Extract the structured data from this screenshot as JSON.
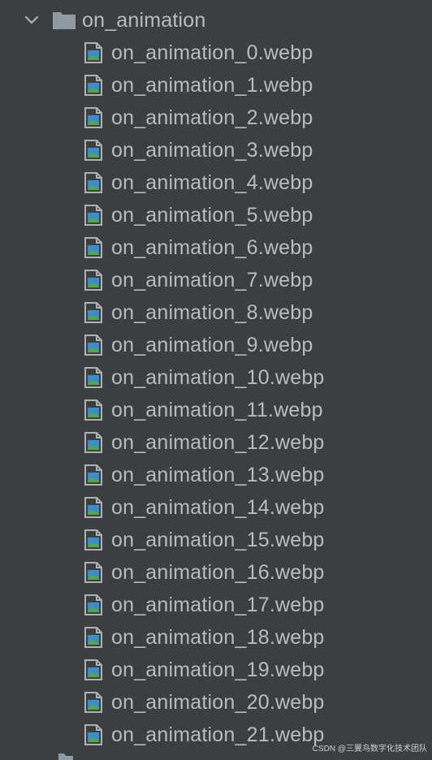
{
  "folder": {
    "name": "on_animation",
    "expanded": true,
    "chevron_icon": "chevron-down-icon",
    "icon": "folder-icon"
  },
  "files": [
    {
      "name": "on_animation_0.webp"
    },
    {
      "name": "on_animation_1.webp"
    },
    {
      "name": "on_animation_2.webp"
    },
    {
      "name": "on_animation_3.webp"
    },
    {
      "name": "on_animation_4.webp"
    },
    {
      "name": "on_animation_5.webp"
    },
    {
      "name": "on_animation_6.webp"
    },
    {
      "name": "on_animation_7.webp"
    },
    {
      "name": "on_animation_8.webp"
    },
    {
      "name": "on_animation_9.webp"
    },
    {
      "name": "on_animation_10.webp"
    },
    {
      "name": "on_animation_11.webp"
    },
    {
      "name": "on_animation_12.webp"
    },
    {
      "name": "on_animation_13.webp"
    },
    {
      "name": "on_animation_14.webp"
    },
    {
      "name": "on_animation_15.webp"
    },
    {
      "name": "on_animation_16.webp"
    },
    {
      "name": "on_animation_17.webp"
    },
    {
      "name": "on_animation_18.webp"
    },
    {
      "name": "on_animation_19.webp"
    },
    {
      "name": "on_animation_20.webp"
    },
    {
      "name": "on_animation_21.webp"
    }
  ],
  "file_icon": "image-file-icon",
  "watermark": "CSDN @三翼鸟数字化技术团队",
  "colors": {
    "background": "#3c3f41",
    "text": "#bbbbbb",
    "folder_icon": "#8f9aa4",
    "image_icon_frame": "#afb1b3",
    "image_icon_blue": "#3b8ec9",
    "image_icon_green": "#57a64a"
  }
}
